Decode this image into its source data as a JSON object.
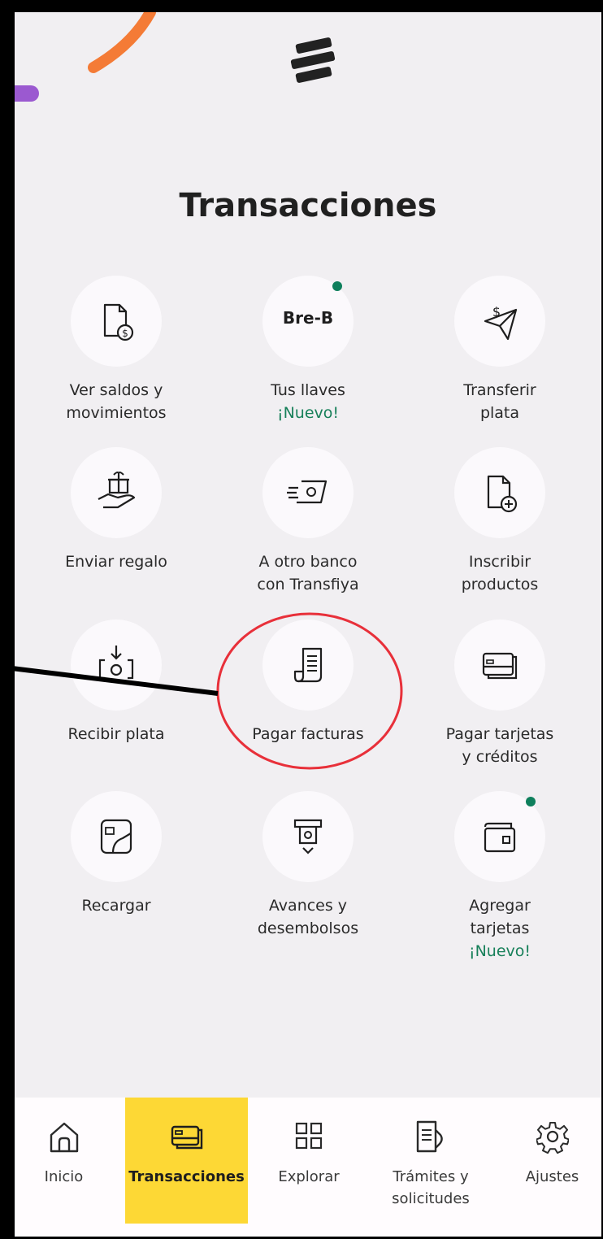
{
  "page": {
    "title": "Transacciones",
    "accent_color": "#FDD835",
    "new_color": "#18805A",
    "badge_color": "#0E7F5C"
  },
  "tiles": [
    {
      "icon": "document-dollar-icon",
      "line1": "Ver saldos y",
      "line2": "movimientos",
      "badge": false
    },
    {
      "icon": "bre-b-logo",
      "icon_text": "Bre-B",
      "line1": "Tus llaves",
      "line2": "¡Nuevo!",
      "badge": true
    },
    {
      "icon": "send-money-icon",
      "line1": "Transferir",
      "line2": "plata",
      "badge": false
    },
    {
      "icon": "gift-hand-icon",
      "line1": "Enviar regalo",
      "badge": false
    },
    {
      "icon": "transfiya-icon",
      "line1": "A otro banco",
      "line2": "con Transfiya",
      "badge": false
    },
    {
      "icon": "document-add-icon",
      "line1": "Inscribir",
      "line2": "productos",
      "badge": false
    },
    {
      "icon": "receive-money-icon",
      "line1": "Recibir plata",
      "badge": false
    },
    {
      "icon": "receipt-icon",
      "line1": "Pagar facturas",
      "badge": false
    },
    {
      "icon": "credit-card-icon",
      "line1": "Pagar tarjetas",
      "line2": "y créditos",
      "badge": false
    },
    {
      "icon": "phone-topup-icon",
      "line1": "Recargar",
      "badge": false
    },
    {
      "icon": "atm-icon",
      "line1": "Avances y",
      "line2": "desembolsos",
      "badge": false
    },
    {
      "icon": "wallet-icon",
      "line1": "Agregar",
      "line2": "tarjetas",
      "line3": "¡Nuevo!",
      "badge": true
    }
  ],
  "nav": [
    {
      "label": "Inicio",
      "icon": "home-icon",
      "active": false
    },
    {
      "label": "Transacciones",
      "icon": "credit-card-icon",
      "active": true
    },
    {
      "label": "Explorar",
      "icon": "grid-icon",
      "active": false
    },
    {
      "label": "Trámites y",
      "label2": "solicitudes",
      "icon": "documents-icon",
      "active": false
    },
    {
      "label": "Ajustes",
      "icon": "gear-icon",
      "active": false
    }
  ]
}
